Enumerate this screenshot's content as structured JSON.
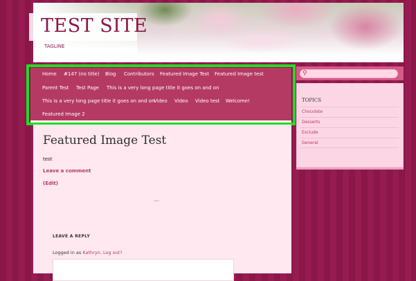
{
  "site": {
    "title": "TEST SITE",
    "tagline": "TAGLINE"
  },
  "nav": {
    "rows": [
      [
        "Home",
        "#147 (no title)",
        "Blog",
        "Contributors",
        "Featured Image Test",
        "Featured Image test"
      ],
      [
        "Parent Test",
        "Test Page",
        "This is a very long page title it goes on and on"
      ],
      [
        "This is a very long page title it goes on and on",
        "Video",
        "Video",
        "Video test",
        "Welcome!"
      ],
      [
        "Featured Image 2"
      ]
    ]
  },
  "post": {
    "title": "Featured Image Test",
    "body": "test",
    "leave_comment": "Leave a comment",
    "edit": "(Edit)",
    "ornament": "∽"
  },
  "reply": {
    "heading": "LEAVE A REPLY",
    "logged_in_prefix": "Logged in as",
    "user": "Kathryn",
    "logout": "Log out?"
  },
  "sidebar": {
    "search_placeholder": "",
    "widget_title": "TOPICS",
    "categories": [
      "Chocolate",
      "Desserts",
      "Exclude",
      "General"
    ]
  },
  "colors": {
    "accent": "#b53a63",
    "highlight": "#22dd22",
    "background": "#8a1748"
  }
}
